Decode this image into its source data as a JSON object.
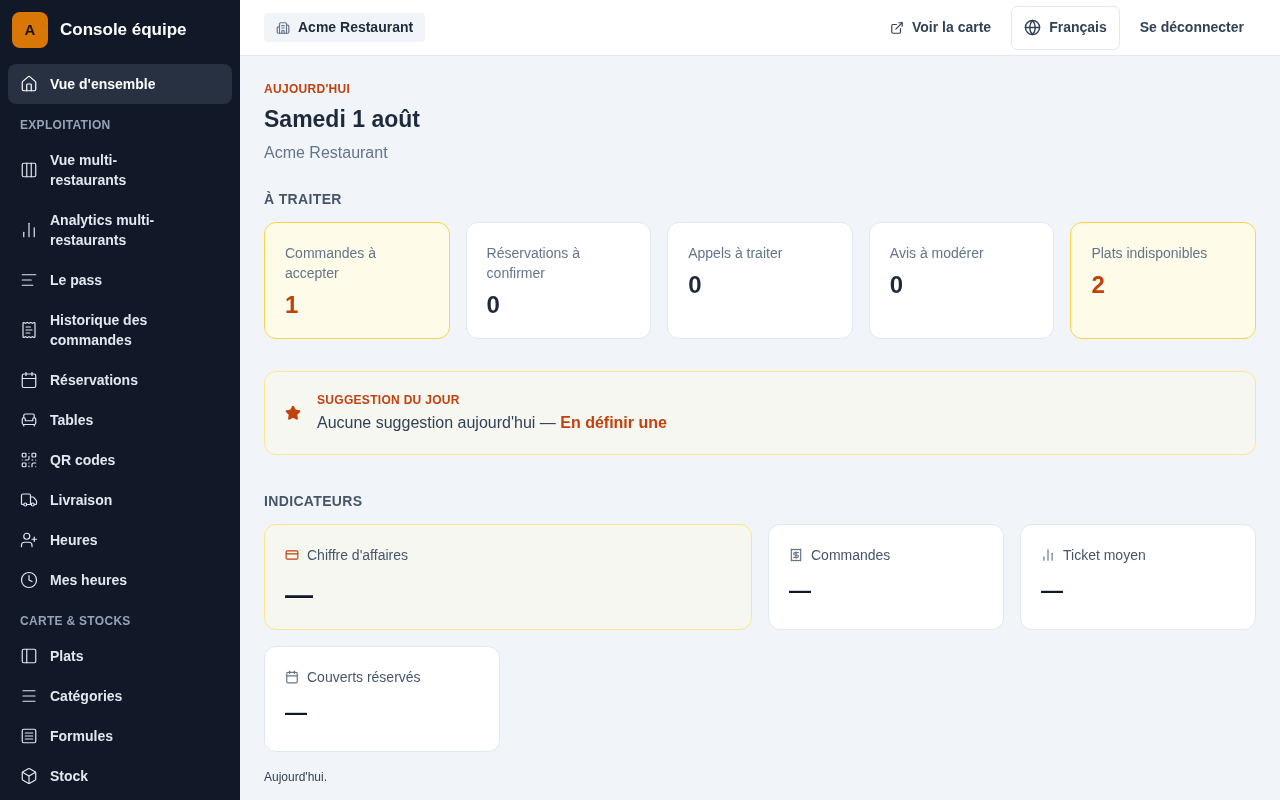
{
  "brand": {
    "initial": "A",
    "name": "Console équipe"
  },
  "sidebar": {
    "sections": [
      {
        "items": [
          {
            "label": "Vue d'ensemble",
            "selected": true
          }
        ]
      },
      {
        "title": "EXPLOITATION",
        "items": [
          {
            "label": "Vue multi-restaurants",
            "selected": false
          },
          {
            "label": "Analytics multi-restaurants",
            "selected": false
          },
          {
            "label": "Le pass",
            "selected": false
          },
          {
            "label": "Historique des commandes",
            "selected": false
          },
          {
            "label": "Réservations",
            "selected": false
          },
          {
            "label": "Tables",
            "selected": false
          },
          {
            "label": "QR codes",
            "selected": false
          },
          {
            "label": "Livraison",
            "selected": false
          },
          {
            "label": "Heures",
            "selected": false
          },
          {
            "label": "Mes heures",
            "selected": false
          }
        ]
      },
      {
        "title": "CARTE & STOCKS",
        "items": [
          {
            "label": "Plats",
            "selected": false
          },
          {
            "label": "Catégories",
            "selected": false
          },
          {
            "label": "Formules",
            "selected": false
          },
          {
            "label": "Stock",
            "selected": false
          }
        ]
      }
    ]
  },
  "topbar": {
    "restaurant": "Acme Restaurant",
    "view_menu": "Voir la carte",
    "language": "Français",
    "logout": "Se déconnecter"
  },
  "header": {
    "eyebrow": "AUJOURD'HUI",
    "title": "Samedi 1 août",
    "subtitle": "Acme Restaurant"
  },
  "todo": {
    "title": "À TRAITER",
    "cards": [
      {
        "label": "Commandes à accepter",
        "value": "1",
        "highlighted": true
      },
      {
        "label": "Réservations à confirmer",
        "value": "0",
        "highlighted": false
      },
      {
        "label": "Appels à traiter",
        "value": "0",
        "highlighted": false
      },
      {
        "label": "Avis à modérer",
        "value": "0",
        "highlighted": false
      },
      {
        "label": "Plats indisponibles",
        "value": "2",
        "highlighted": true
      }
    ]
  },
  "suggestion": {
    "eyebrow": "SUGGESTION DU JOUR",
    "text": "Aucune suggestion aujourd'hui —",
    "link": "En définir une"
  },
  "indicators": {
    "title": "INDICATEURS",
    "cards": [
      {
        "label": "Chiffre d'affaires",
        "value": "—",
        "highlighted": true
      },
      {
        "label": "Commandes",
        "value": "—",
        "highlighted": false
      },
      {
        "label": "Ticket moyen",
        "value": "—",
        "highlighted": false
      },
      {
        "label": "Couverts réservés",
        "value": "—",
        "highlighted": false
      }
    ],
    "note": "Aujourd'hui."
  }
}
